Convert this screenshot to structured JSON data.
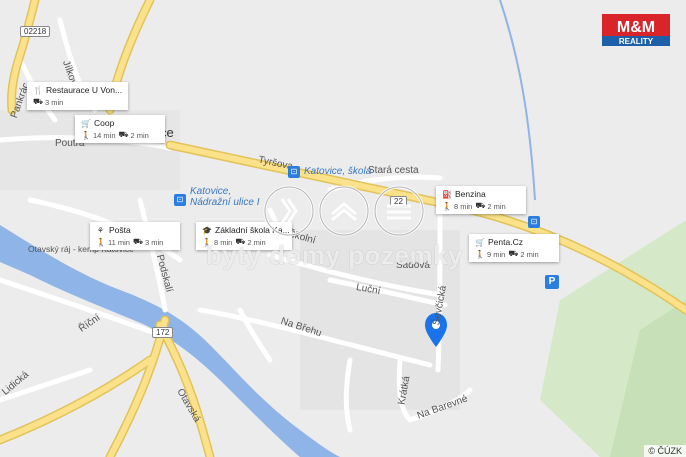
{
  "map": {
    "town_fragment": "ce",
    "road_numbers": [
      "02218",
      "22",
      "172"
    ],
    "streets": [
      "Pankrác",
      "Jílková",
      "Tyršova",
      "Stará cesta",
      "Školní",
      "Sadová",
      "Luční",
      "Na Břehu",
      "Krátká",
      "Na Barevné",
      "Ševčická",
      "Říční",
      "Podskalí",
      "Čelakovská",
      "Otavská",
      "Lidická",
      "Poutrá"
    ],
    "places": [
      "Otavský ráj - kemp Katovice",
      "Katovice, škola",
      "Katovice, Nádražní ulice I"
    ],
    "attribution": "© ČÚZK"
  },
  "pois": [
    {
      "id": "restaurace",
      "icon": "restaurant-icon",
      "name": "Restaurace U Von...",
      "walk": "",
      "drive": "3 min"
    },
    {
      "id": "coop",
      "icon": "shopping-cart-icon",
      "name": "Coop",
      "walk": "14 min",
      "drive": "2 min"
    },
    {
      "id": "posta",
      "icon": "post-office-icon",
      "name": "Pošta",
      "walk": "11 min",
      "drive": "3 min"
    },
    {
      "id": "skola",
      "icon": "school-icon",
      "name": "Základní škola Ka...",
      "walk": "8 min",
      "drive": "2 min"
    },
    {
      "id": "benzina",
      "icon": "gas-station-icon",
      "name": "Benzina",
      "walk": "8 min",
      "drive": "2 min"
    },
    {
      "id": "penta",
      "icon": "shopping-cart-icon",
      "name": "Penta.Cz",
      "walk": "9 min",
      "drive": "2 min"
    }
  ],
  "watermark": {
    "text": "byty domy pozemky"
  },
  "logo": {
    "top": "M&M",
    "bottom": "REALITY",
    "color": "#d9252a"
  },
  "colors": {
    "marker": "#1a73e8",
    "river": "#8fb4e8",
    "road_major": "#fbe28a",
    "green": "#d5e9c8"
  }
}
